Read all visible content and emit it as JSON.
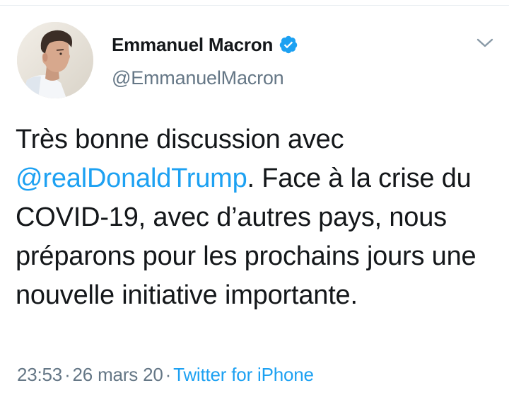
{
  "tweet": {
    "author": {
      "display_name": "Emmanuel Macron",
      "handle": "@EmmanuelMacron",
      "verified": true,
      "avatar_icon": "profile-photo"
    },
    "text": {
      "part1": "Très bonne discussion avec ",
      "mention": "@realDonaldTrump",
      "part2": ". Face à la crise du COVID-19, avec d’autres pays, nous préparons pour les prochains jours une nouvelle initiative importante."
    },
    "meta": {
      "time": "23:53",
      "separator": "·",
      "date": "26 mars 20",
      "source": "Twitter for iPhone"
    },
    "menu_icon": "chevron-down-icon"
  },
  "colors": {
    "link": "#1da1f2",
    "secondary_text": "#657786",
    "primary_text": "#14171a",
    "verified_badge": "#1da1f2"
  }
}
